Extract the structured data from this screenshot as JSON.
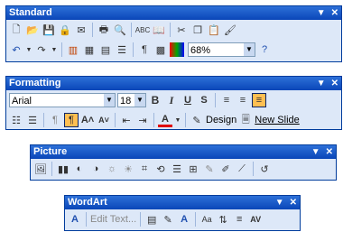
{
  "toolbars": {
    "standard": {
      "title": "Standard",
      "row2": {
        "zoom": "68%"
      }
    },
    "formatting": {
      "title": "Formatting",
      "font": "Arial",
      "size": "18",
      "design_label": "Design",
      "new_slide_label": "New Slide"
    },
    "picture": {
      "title": "Picture"
    },
    "wordart": {
      "title": "WordArt",
      "edit_text_label": "Edit Text..."
    }
  },
  "icons": [
    "new-document",
    "open-folder",
    "save",
    "permission",
    "email",
    "print",
    "print-preview",
    "spelling",
    "research",
    "cut",
    "copy",
    "paste",
    "format-painter",
    "undo",
    "redo",
    "insert-chart",
    "insert-table",
    "tables-borders",
    "expand-all",
    "show-formatting",
    "grid",
    "color-grayscale",
    "help",
    "bold",
    "italic",
    "underline",
    "shadow",
    "align-left",
    "center",
    "align-right",
    "numbering",
    "bullets",
    "increase-font",
    "decrease-font",
    "decrease-indent",
    "increase-indent",
    "font-color",
    "insert-picture",
    "image-control",
    "more-contrast",
    "less-contrast",
    "more-brightness",
    "less-brightness",
    "crop",
    "rotate-left",
    "line-style",
    "compress",
    "recolor",
    "format-picture",
    "set-transparent",
    "reset-picture",
    "insert-wordart",
    "wordart-gallery",
    "format-wordart",
    "wordart-shape",
    "wordart-same-height",
    "wordart-vertical",
    "wordart-alignment",
    "wordart-spacing"
  ],
  "colors": {
    "title_bar": "#0a46b8",
    "toolbar_bg": "#dde8f8",
    "selected": "#ffbf52"
  }
}
